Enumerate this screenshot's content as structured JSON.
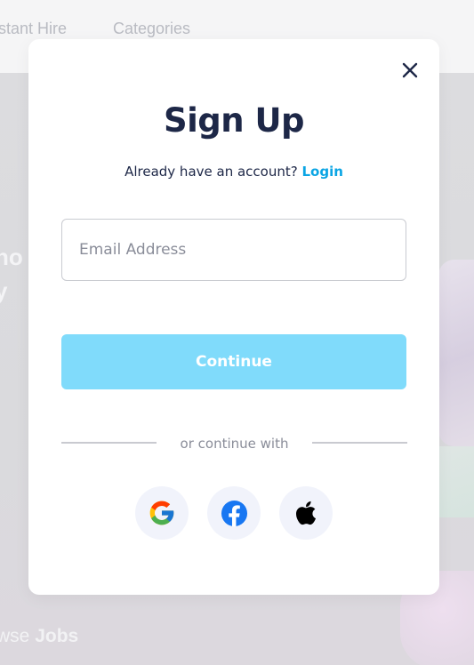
{
  "background": {
    "nav": {
      "instant_hire_label": "stant Hire",
      "categories_label": "Categories"
    },
    "hero_line_1": "no",
    "hero_line_2": "y",
    "browse_prefix": "wse",
    "browse_bold": "Jobs"
  },
  "modal": {
    "title": "Sign Up",
    "subtitle_text": "Already have an account?",
    "login_link": "Login",
    "email": {
      "placeholder": "Email Address",
      "value": ""
    },
    "continue_label": "Continue",
    "divider_text": "or continue with",
    "social": [
      {
        "name": "google",
        "icon": "google-icon"
      },
      {
        "name": "facebook",
        "icon": "facebook-icon"
      },
      {
        "name": "apple",
        "icon": "apple-icon"
      }
    ]
  },
  "colors": {
    "brand_dark": "#1d2747",
    "link": "#0ba5e4",
    "continue_button": "#80dbfb",
    "social_button_bg": "#f1f3fb",
    "facebook_blue": "#1877f2"
  }
}
